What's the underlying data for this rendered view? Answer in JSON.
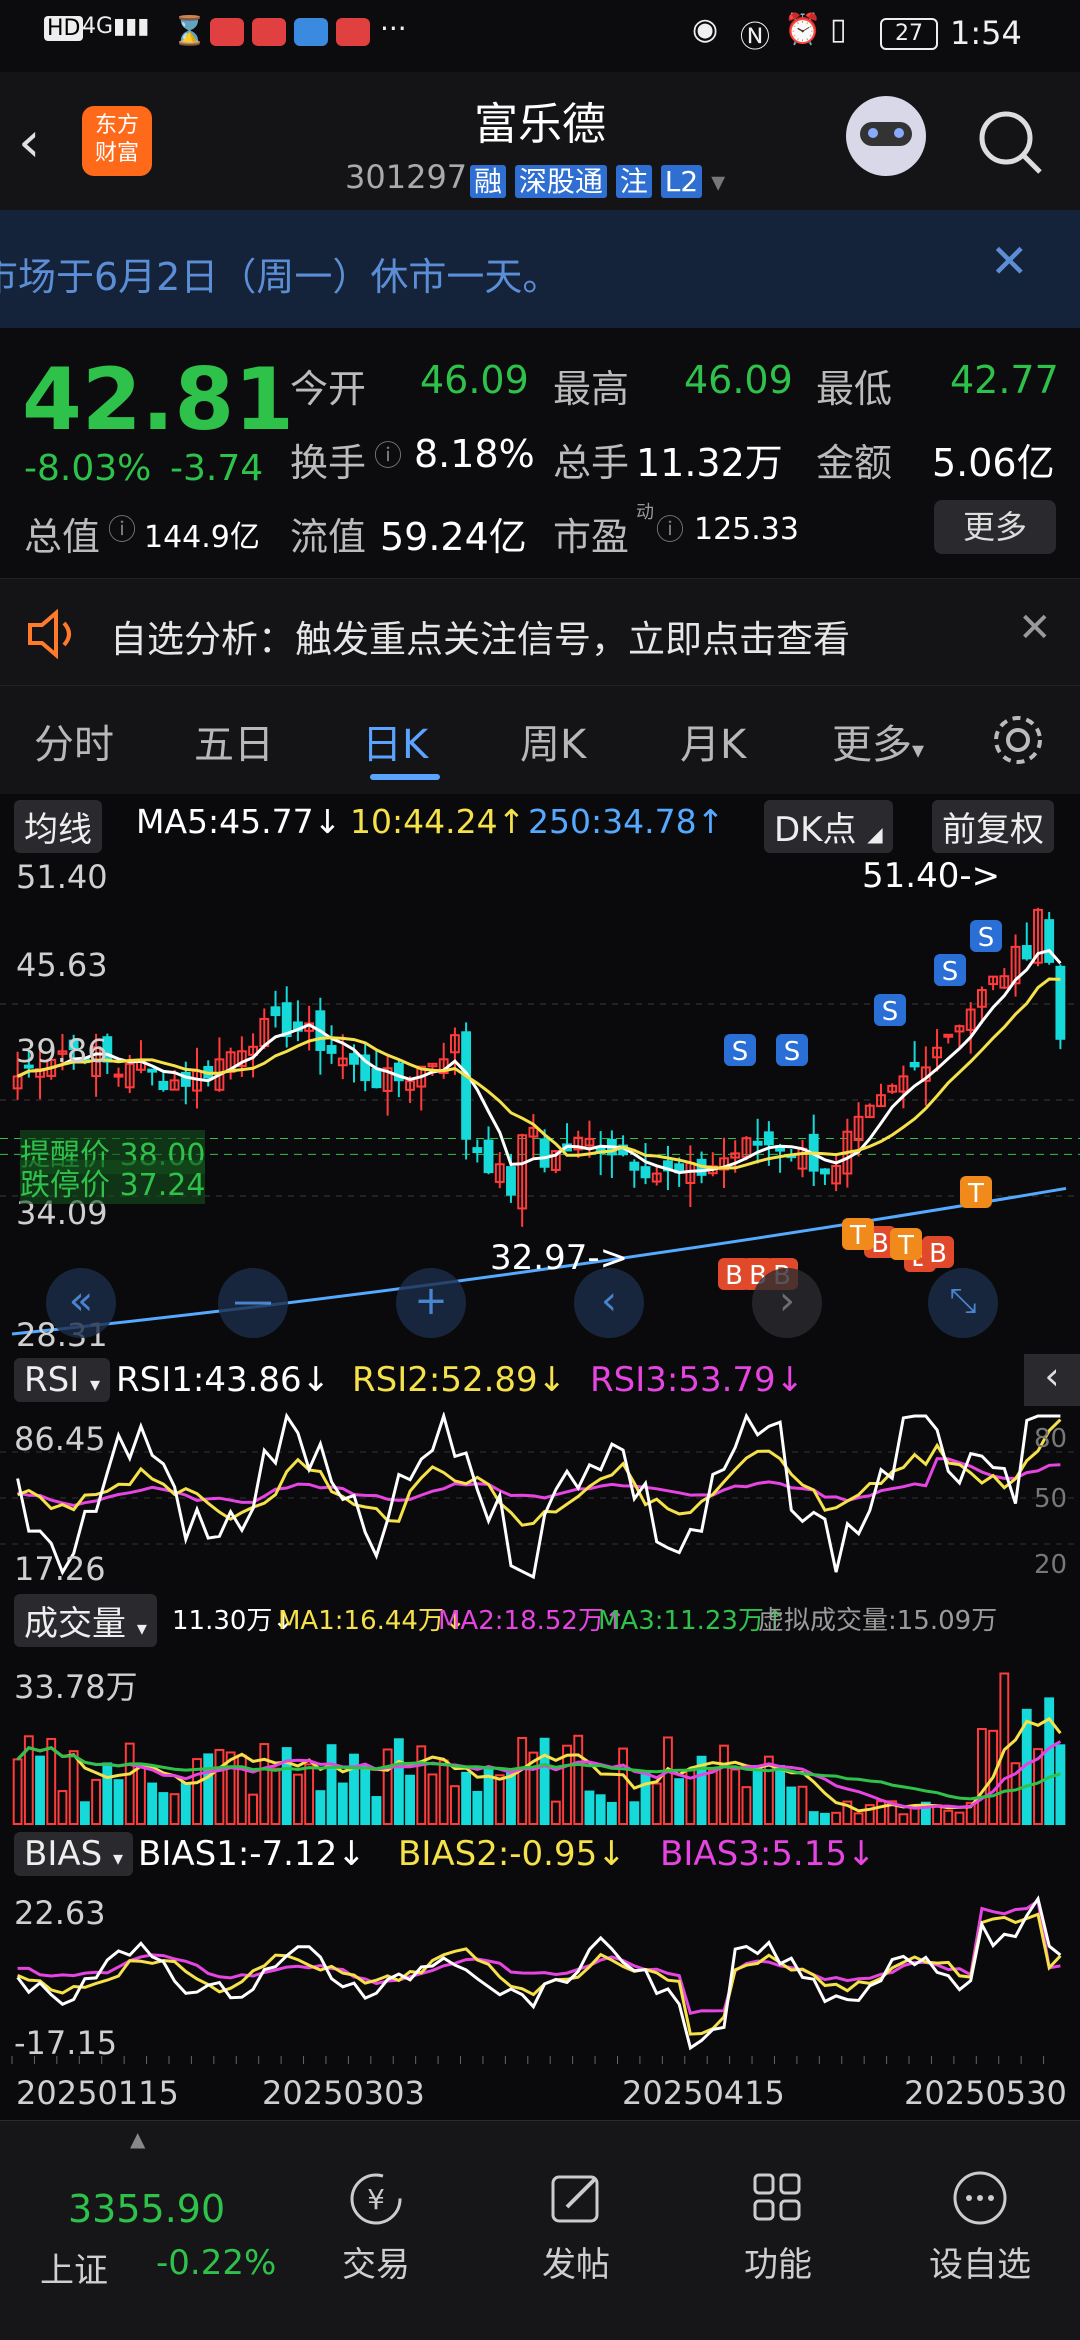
{
  "status": {
    "time": "1:54",
    "battery": "27"
  },
  "nav": {
    "logo_top": "东方",
    "logo_bottom": "财富",
    "title": "富乐德",
    "code": "301297",
    "badges": [
      "融",
      "深股通",
      "注",
      "L2"
    ]
  },
  "banner": {
    "text": "市场于6月2日（周一）休市一天。"
  },
  "quote": {
    "price": "42.81",
    "change_pct": "-8.03%",
    "change": "-3.74",
    "open_label": "今开",
    "open": "46.09",
    "high_label": "最高",
    "high": "46.09",
    "low_label": "最低",
    "low": "42.77",
    "turnover_label": "换手",
    "turnover": "8.18%",
    "volume_label": "总手",
    "volume": "11.32万",
    "amount_label": "金额",
    "amount": "5.06亿",
    "mktcap_label": "总值",
    "mktcap": "144.9亿",
    "float_label": "流值",
    "float": "59.24亿",
    "pe_label": "市盈",
    "pe_sup": "动",
    "pe": "125.33",
    "more": "更多"
  },
  "notice": {
    "text": "自选分析：触发重点关注信号，立即点击查看"
  },
  "tabs": [
    "分时",
    "五日",
    "日K",
    "周K",
    "月K",
    "更多"
  ],
  "main_chart": {
    "ma_select": "均线",
    "ma5": "MA5:45.77↓",
    "ma10": "10:44.24↑",
    "ma250": "250:34.78↑",
    "dk": "DK点",
    "fq": "前复权",
    "y_labels": [
      "51.40",
      "45.63",
      "39.86",
      "34.09",
      "28.31"
    ],
    "alert1": "提醒价 38.00",
    "alert2": "跌停价 37.24",
    "max_note": "51.40->",
    "min_note": "32.97->"
  },
  "rsi": {
    "select": "RSI",
    "rsi1": "RSI1:43.86↓",
    "rsi2": "RSI2:52.89↓",
    "rsi3": "RSI3:53.79↓",
    "y_top": "86.45",
    "y_bot": "17.26",
    "r80": "80",
    "r50": "50",
    "r20": "20"
  },
  "vol": {
    "select": "成交量",
    "v": "11.30万↓",
    "ma1": "MA1:16.44万↓",
    "ma2": "MA2:18.52万↑",
    "ma3": "MA3:11.23万↑",
    "virtual": "虚拟成交量:15.09万",
    "y_top": "33.78万"
  },
  "bias": {
    "select": "BIAS",
    "b1": "BIAS1:-7.12↓",
    "b2": "BIAS2:-0.95↓",
    "b3": "BIAS3:5.15↓",
    "y_top": "22.63",
    "y_bot": "-17.15"
  },
  "dates": [
    "20250115",
    "20250303",
    "20250415",
    "20250530"
  ],
  "bottom": {
    "index_value": "3355.90",
    "index_name": "上证",
    "index_change": "-0.22%",
    "items": [
      "交易",
      "发帖",
      "功能",
      "设自选"
    ]
  },
  "colors": {
    "up": "#ff3b3b",
    "down": "#16d9d9",
    "ma5": "#ffffff",
    "ma10": "#f5e14a",
    "ma250": "#55aaff",
    "accent": "#5aa3ff"
  }
}
